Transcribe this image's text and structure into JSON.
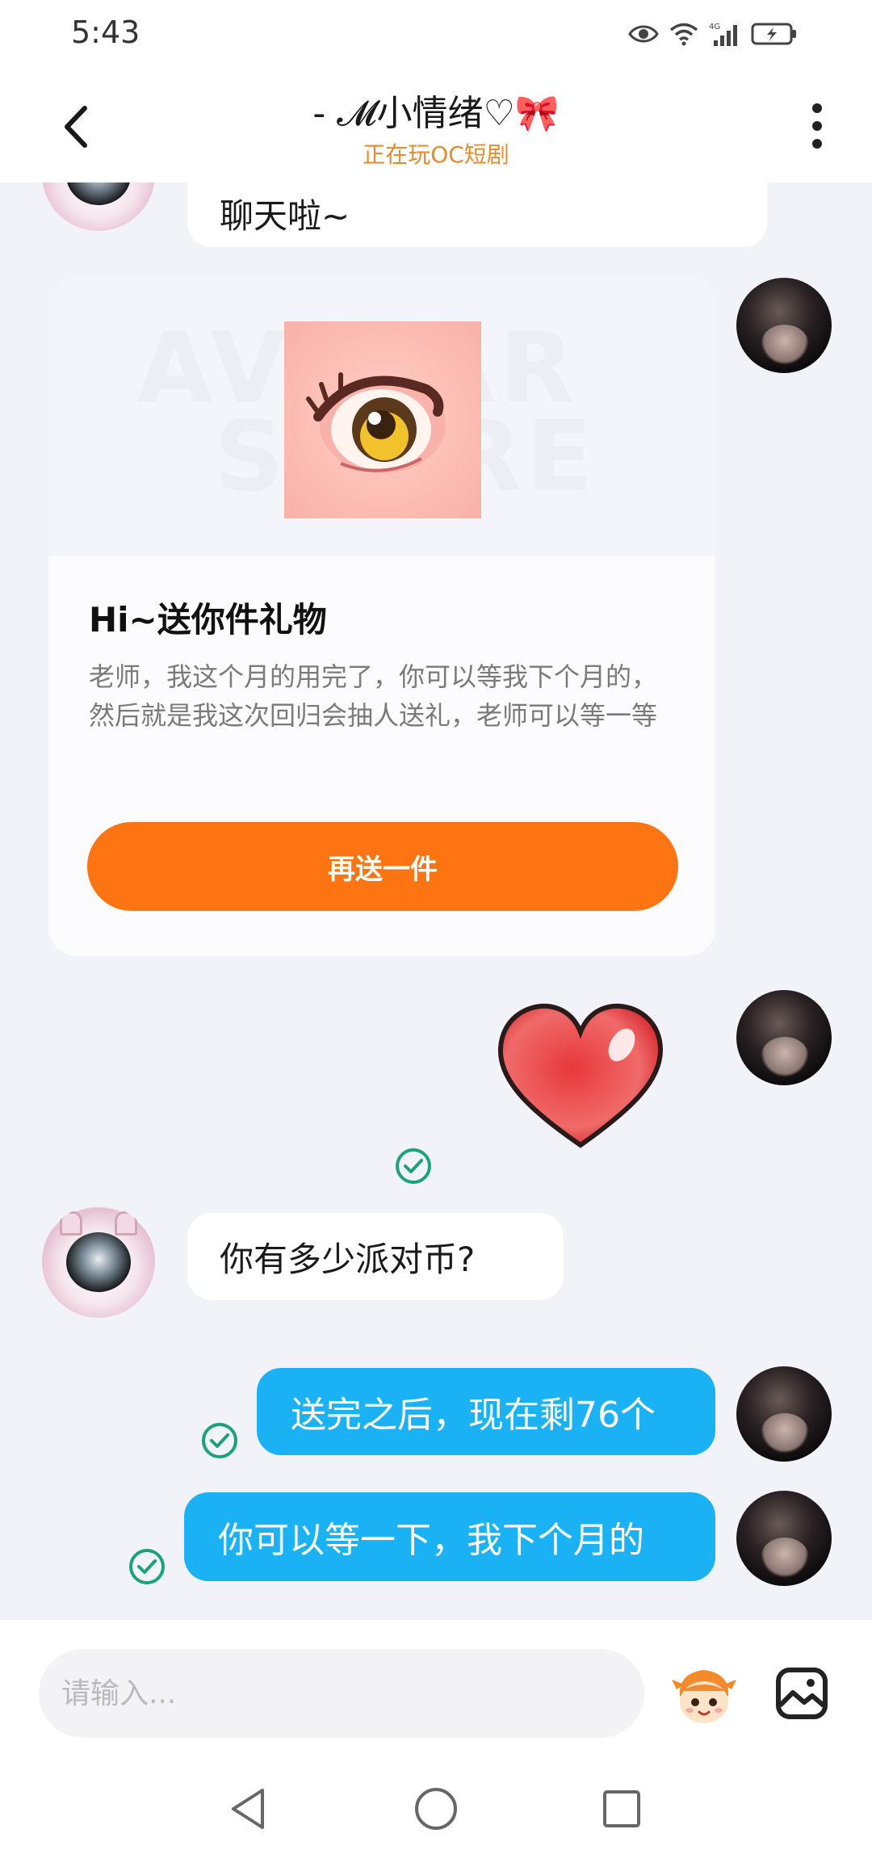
{
  "status_bar": {
    "time": "5:43",
    "network": "4G"
  },
  "header": {
    "title": "- 𝓜小情绪♡🎀",
    "subtitle": "正在玩OC短剧"
  },
  "messages": {
    "partial_text": "聊天啦~",
    "gift_card": {
      "watermark": "AVATAR\nSTORE",
      "title": "Hi~送你件礼物",
      "description": "老师，我这个月的用完了，你可以等我下个月的，然后就是我这次回归会抽人送礼，老师可以等一等",
      "button_label": "再送一件"
    },
    "question": "你有多少派对币?",
    "reply1": "送完之后，现在剩76个",
    "reply2": "你可以等一下，我下个月的"
  },
  "input": {
    "placeholder": "请输入..."
  },
  "colors": {
    "accent_orange": "#fd7512",
    "bubble_blue": "#1ab2f5",
    "sent_check": "#1ba27a",
    "subtitle_orange": "#e58a2e"
  }
}
